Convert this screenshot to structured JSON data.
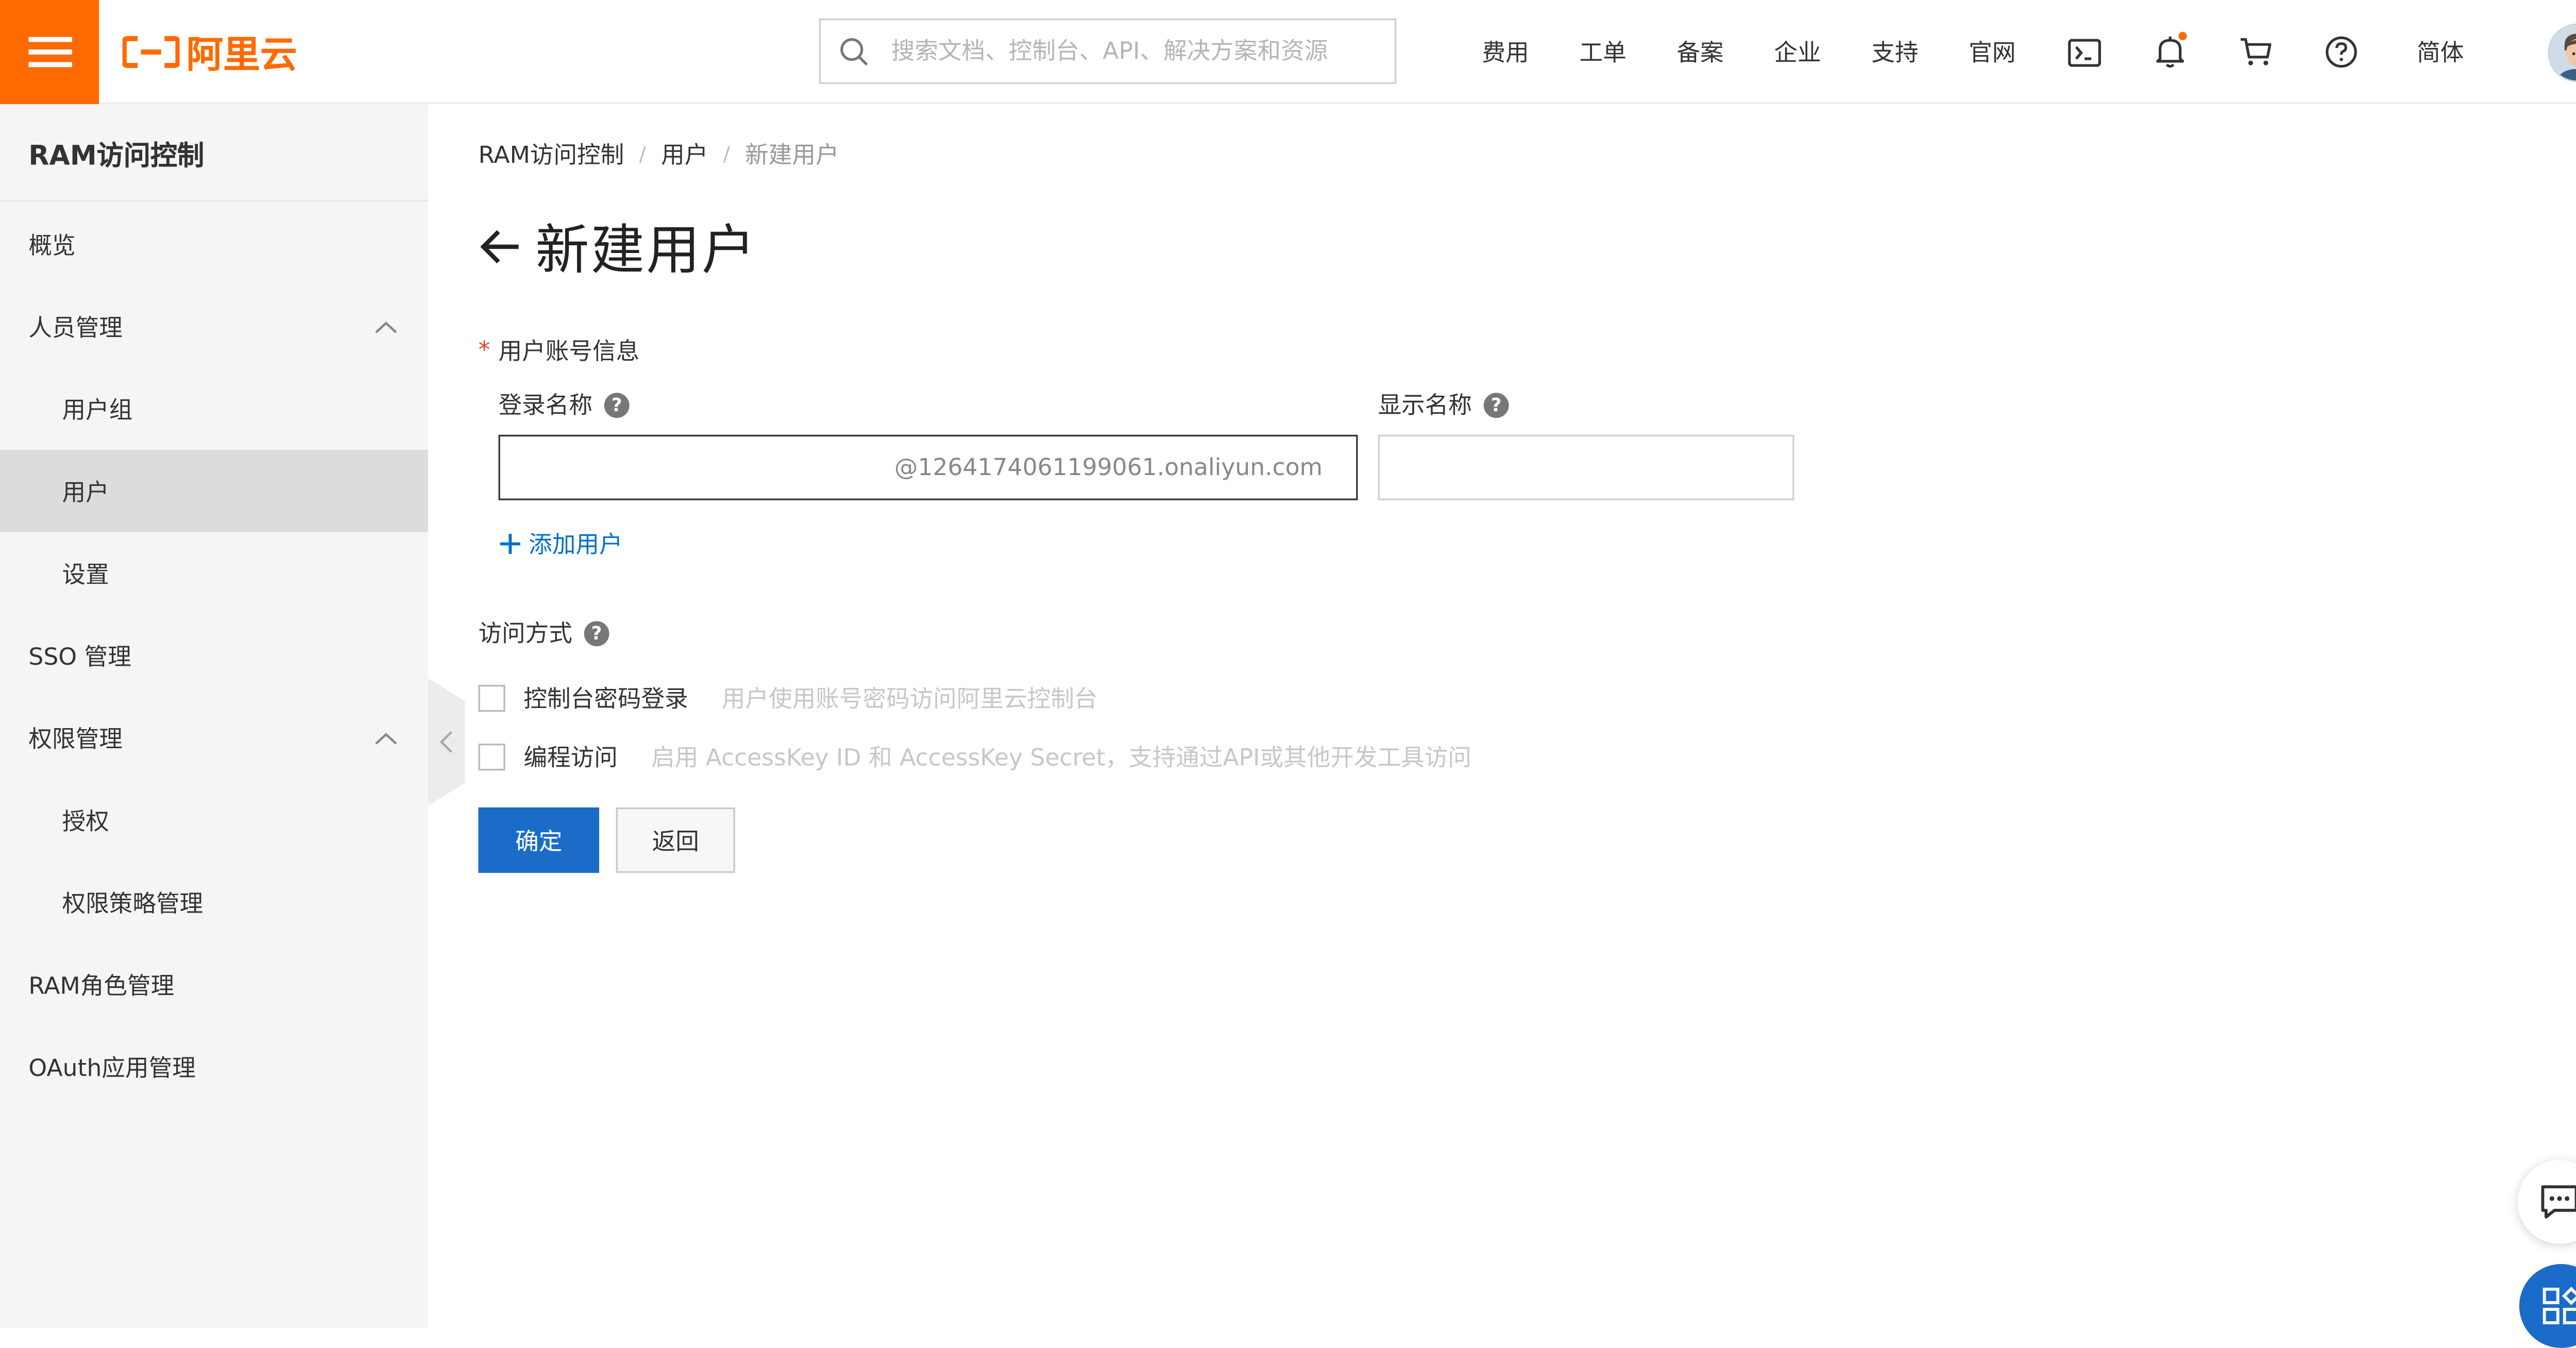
{
  "topbar": {
    "logo_text": "阿里云",
    "search_placeholder": "搜索文档、控制台、API、解决方案和资源",
    "nav": [
      "费用",
      "工单",
      "备案",
      "企业",
      "支持",
      "官网"
    ],
    "language": "简体",
    "icons": [
      "terminal-icon",
      "bell-icon",
      "cart-icon",
      "help-circle-icon"
    ],
    "brand_color": "#ff6a00"
  },
  "sidebar": {
    "title": "RAM访问控制",
    "items": [
      {
        "label": "概览"
      },
      {
        "label": "人员管理"
      },
      {
        "label": "用户组"
      },
      {
        "label": "用户"
      },
      {
        "label": "设置"
      },
      {
        "label": "SSO 管理"
      },
      {
        "label": "权限管理"
      },
      {
        "label": "授权"
      },
      {
        "label": "权限策略管理"
      },
      {
        "label": "RAM角色管理"
      },
      {
        "label": "OAuth应用管理"
      }
    ],
    "active_item": "用户"
  },
  "main": {
    "breadcrumb": [
      "RAM访问控制",
      "用户",
      "新建用户"
    ],
    "title": "新建用户",
    "account_section": {
      "label": "用户账号信息",
      "login_name_label": "登录名称",
      "login_name_value": "",
      "login_suffix": "@1264174061199061.onaliyun.com",
      "display_name_label": "显示名称",
      "display_name_value": "",
      "add_user": "添加用户"
    },
    "access_section": {
      "label": "访问方式",
      "console_label": "控制台密码登录",
      "console_desc": "用户使用账号密码访问阿里云控制台",
      "console_checked": false,
      "api_label": "编程访问",
      "api_desc": "启用 AccessKey ID 和 AccessKey Secret，支持通过API或其他开发工具访问",
      "api_checked": false
    },
    "buttons": {
      "confirm": "确定",
      "back": "返回"
    },
    "accent_color": "#1a6cc8"
  }
}
